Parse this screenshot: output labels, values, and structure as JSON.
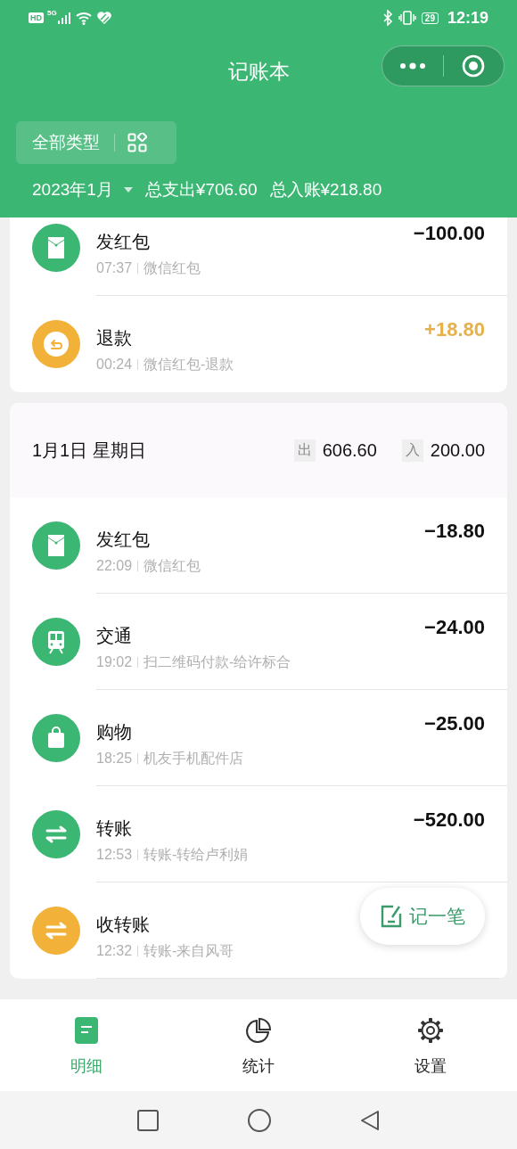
{
  "status_bar": {
    "hd": "HD",
    "network": "5G",
    "battery": "29",
    "time": "12:19"
  },
  "header": {
    "title": "记账本"
  },
  "filter": {
    "label": "全部类型"
  },
  "summary": {
    "month": "2023年1月",
    "expense": "总支出¥706.60",
    "income": "总入账¥218.80"
  },
  "groups": [
    {
      "transactions": [
        {
          "kind": "envelope",
          "color": "#3bb673",
          "title": "发红包",
          "time": "07:37",
          "note": "微信红包",
          "amount": "−100.00",
          "income": false
        },
        {
          "kind": "refund",
          "color": "#f2b23a",
          "title": "退款",
          "time": "00:24",
          "note": "微信红包-退款",
          "amount": "+18.80",
          "income": true
        }
      ]
    },
    {
      "date": "1月1日 星期日",
      "out_label": "出",
      "out_total": "606.60",
      "in_label": "入",
      "in_total": "200.00",
      "transactions": [
        {
          "kind": "envelope",
          "color": "#3bb673",
          "title": "发红包",
          "time": "22:09",
          "note": "微信红包",
          "amount": "−18.80",
          "income": false
        },
        {
          "kind": "train",
          "color": "#3bb673",
          "title": "交通",
          "time": "19:02",
          "note": "扫二维码付款-给许标合",
          "amount": "−24.00",
          "income": false
        },
        {
          "kind": "bag",
          "color": "#3bb673",
          "title": "购物",
          "time": "18:25",
          "note": "机友手机配件店",
          "amount": "−25.00",
          "income": false
        },
        {
          "kind": "transfer",
          "color": "#3bb673",
          "title": "转账",
          "time": "12:53",
          "note": "转账-转给卢利娟",
          "amount": "−520.00",
          "income": false
        },
        {
          "kind": "transfer",
          "color": "#f2b23a",
          "title": "收转账",
          "time": "12:32",
          "note": "转账-来自风哥"
        }
      ]
    }
  ],
  "fab": {
    "label": "记一笔"
  },
  "tabs": [
    {
      "label": "明细",
      "selected": true
    },
    {
      "label": "统计",
      "selected": false
    },
    {
      "label": "设置",
      "selected": false
    }
  ]
}
